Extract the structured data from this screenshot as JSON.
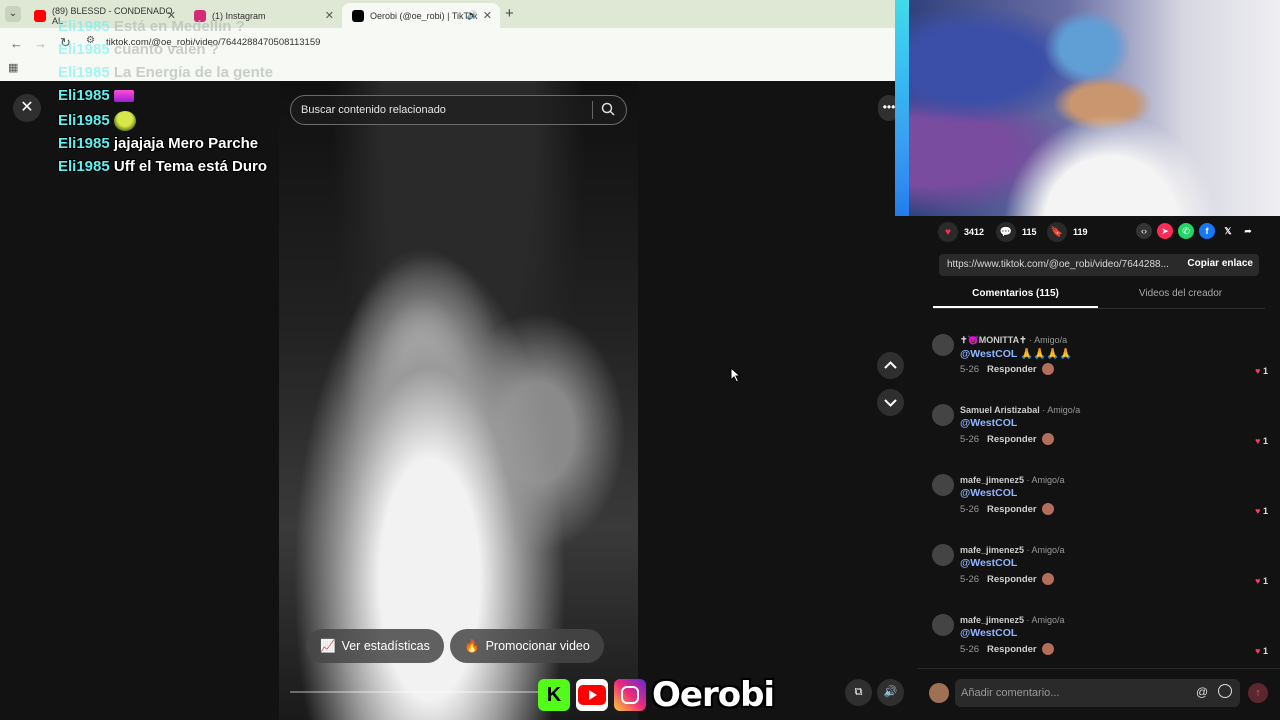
{
  "browser": {
    "tabs": [
      {
        "title": "(89) BLESSD - CONDENADO AL",
        "favicon_color": "#ff0000"
      },
      {
        "title": "(1) Instagram",
        "favicon_color": "#d62976"
      },
      {
        "title": "Oerobi (@oe_robi) | TikTok",
        "favicon_color": "#000000"
      }
    ],
    "url": "tiktok.com/@oe_robi/video/7644288470508113159"
  },
  "player": {
    "search_placeholder": "Buscar contenido relacionado",
    "btn_stats": "Ver estadísticas",
    "btn_promote": "Promocionar video"
  },
  "chat": [
    {
      "user": "Eli1985",
      "msg": "Está en Medellín ?"
    },
    {
      "user": "Eli1985",
      "msg": "cuanto valen ?"
    },
    {
      "user": "Eli1985",
      "msg": "La Energía de la gente"
    },
    {
      "user": "Eli1985",
      "msg": ""
    },
    {
      "user": "Eli1985",
      "msg": ""
    },
    {
      "user": "Eli1985",
      "msg": "jajajaja Mero Parche"
    },
    {
      "user": "Eli1985",
      "msg": "Uff el Tema está Duro"
    }
  ],
  "brand": {
    "name": "Oerobi",
    "k_letter": "K"
  },
  "panel": {
    "likes": "3412",
    "comments_count": "115",
    "saves": "119",
    "link": "https://www.tiktok.com/@oe_robi/video/7644288...",
    "copy_label": "Copiar enlace",
    "tab_comments": "Comentarios (115)",
    "tab_videos": "Videos del creador",
    "add_comment_placeholder": "Añadir comentario..."
  },
  "comments": [
    {
      "name": "✝😈MONITTA✝",
      "relation": " · Amigo/a",
      "text": "@WestCOL",
      "emoji": " 🙏🙏🙏🙏",
      "date": "5-26",
      "reply": "Responder",
      "likes": "1"
    },
    {
      "name": "Samuel Aristizabal",
      "relation": " · Amigo/a",
      "text": "@WestCOL",
      "emoji": "",
      "date": "5-26",
      "reply": "Responder",
      "likes": "1"
    },
    {
      "name": "mafe_jimenez5",
      "relation": " · Amigo/a",
      "text": "@WestCOL",
      "emoji": "",
      "date": "5-26",
      "reply": "Responder",
      "likes": "1"
    },
    {
      "name": "mafe_jimenez5",
      "relation": " · Amigo/a",
      "text": "@WestCOL",
      "emoji": "",
      "date": "5-26",
      "reply": "Responder",
      "likes": "1"
    },
    {
      "name": "mafe_jimenez5",
      "relation": " · Amigo/a",
      "text": "@WestCOL",
      "emoji": "",
      "date": "5-26",
      "reply": "Responder",
      "likes": "1"
    }
  ],
  "colors": {
    "accent": "#fe2c55",
    "chat_user": "#5ff0f0",
    "mention": "#8fb6ff"
  }
}
